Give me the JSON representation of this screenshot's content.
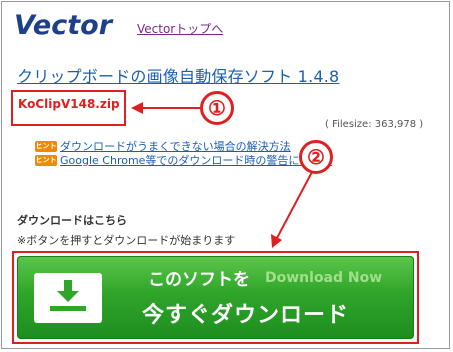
{
  "header": {
    "logo_text": "Vector",
    "top_link": "Vectorトップへ"
  },
  "title": "クリップボードの画像自動保存ソフト 1.4.8",
  "file": {
    "name": "KoClipV148.zip",
    "filesize_label": "( Filesize:  363,978 )"
  },
  "hints": [
    {
      "badge": "ヒント",
      "text": "ダウンロードがうまくできない場合の解決方法"
    },
    {
      "badge": "ヒント",
      "text": "Google Chrome等でのダウンロード時の警告について"
    }
  ],
  "download": {
    "heading": "ダウンロードはこちら",
    "note": "※ボタンを押すとダウンロードが始まります",
    "button_line1": "このソフトを",
    "button_en": "Download Now",
    "button_line2": "今すぐダウンロード"
  },
  "annotations": {
    "marker1": "①",
    "marker2": "②",
    "color": "#e02020"
  },
  "colors": {
    "link": "#1a5fb4",
    "visited_link": "#7a2a8a",
    "button_green": "#2fa52a",
    "hint_badge": "#f08a00"
  }
}
